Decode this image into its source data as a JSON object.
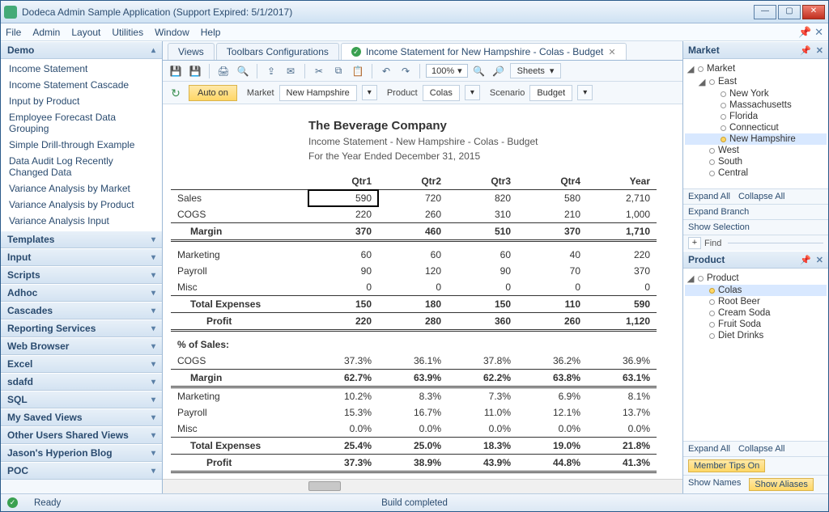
{
  "window": {
    "title": "Dodeca Admin Sample Application (Support Expired: 5/1/2017)"
  },
  "menu": [
    "File",
    "Admin",
    "Layout",
    "Utilities",
    "Window",
    "Help"
  ],
  "sidebar": {
    "groups": [
      {
        "label": "Demo",
        "open": true,
        "items": [
          "Income Statement",
          "Income Statement Cascade",
          "Input by Product",
          "Employee Forecast Data Grouping",
          "Simple Drill-through Example",
          "Data Audit Log Recently Changed Data",
          "Variance Analysis by Market",
          "Variance Analysis by Product",
          "Variance Analysis Input"
        ]
      },
      {
        "label": "Templates"
      },
      {
        "label": "Input"
      },
      {
        "label": "Scripts"
      },
      {
        "label": "Adhoc"
      },
      {
        "label": "Cascades"
      },
      {
        "label": "Reporting Services"
      },
      {
        "label": "Web Browser"
      },
      {
        "label": "Excel"
      },
      {
        "label": "sdafd"
      },
      {
        "label": "SQL"
      },
      {
        "label": "My Saved Views"
      },
      {
        "label": "Other Users Shared Views"
      },
      {
        "label": "Jason's Hyperion Blog"
      },
      {
        "label": "POC"
      }
    ]
  },
  "tabs": [
    {
      "label": "Views",
      "active": false
    },
    {
      "label": "Toolbars Configurations",
      "active": false
    },
    {
      "label": "Income Statement for New Hampshire - Colas - Budget",
      "active": true,
      "icon": "check",
      "closable": true
    }
  ],
  "toolbar": {
    "zoom": "100%",
    "sheets_btn": "Sheets"
  },
  "pov": {
    "auto_on": "Auto on",
    "dims": [
      {
        "label": "Market",
        "value": "New Hampshire"
      },
      {
        "label": "Product",
        "value": "Colas"
      },
      {
        "label": "Scenario",
        "value": "Budget"
      }
    ]
  },
  "report": {
    "title": "The Beverage Company",
    "subtitle1": "Income Statement - New Hampshire - Colas - Budget",
    "subtitle2": "For the Year Ended December 31, 2015",
    "columns": [
      "Qtr1",
      "Qtr2",
      "Qtr3",
      "Qtr4",
      "Year"
    ],
    "section_label": "% of Sales:",
    "rows": [
      {
        "label": "Sales",
        "v": [
          "590",
          "720",
          "820",
          "580",
          "2,710"
        ],
        "active_col": 0
      },
      {
        "label": "COGS",
        "v": [
          "220",
          "260",
          "310",
          "210",
          "1,000"
        ],
        "underline": true
      },
      {
        "label": "Margin",
        "v": [
          "370",
          "460",
          "510",
          "370",
          "1,710"
        ],
        "bold": true,
        "indent": 1,
        "double": true
      },
      {
        "spacer": true
      },
      {
        "label": "Marketing",
        "v": [
          "60",
          "60",
          "60",
          "40",
          "220"
        ]
      },
      {
        "label": "Payroll",
        "v": [
          "90",
          "120",
          "90",
          "70",
          "370"
        ]
      },
      {
        "label": "Misc",
        "v": [
          "0",
          "0",
          "0",
          "0",
          "0"
        ],
        "underline": true
      },
      {
        "label": "Total Expenses",
        "v": [
          "150",
          "180",
          "150",
          "110",
          "590"
        ],
        "bold": true,
        "indent": 1,
        "underline": true
      },
      {
        "label": "Profit",
        "v": [
          "220",
          "280",
          "360",
          "260",
          "1,120"
        ],
        "bold": true,
        "indent": 2,
        "double": true
      },
      {
        "spacer": true
      }
    ],
    "pct_rows": [
      {
        "label": "COGS",
        "v": [
          "37.3%",
          "36.1%",
          "37.8%",
          "36.2%",
          "36.9%"
        ],
        "underline": true
      },
      {
        "label": "Margin",
        "v": [
          "62.7%",
          "63.9%",
          "62.2%",
          "63.8%",
          "63.1%"
        ],
        "bold": true,
        "indent": 1,
        "double": true
      },
      {
        "label": "Marketing",
        "v": [
          "10.2%",
          "8.3%",
          "7.3%",
          "6.9%",
          "8.1%"
        ]
      },
      {
        "label": "Payroll",
        "v": [
          "15.3%",
          "16.7%",
          "11.0%",
          "12.1%",
          "13.7%"
        ]
      },
      {
        "label": "Misc",
        "v": [
          "0.0%",
          "0.0%",
          "0.0%",
          "0.0%",
          "0.0%"
        ],
        "underline": true
      },
      {
        "label": "Total Expenses",
        "v": [
          "25.4%",
          "25.0%",
          "18.3%",
          "19.0%",
          "21.8%"
        ],
        "bold": true,
        "indent": 1,
        "underline": true
      },
      {
        "label": "Profit",
        "v": [
          "37.3%",
          "38.9%",
          "43.9%",
          "44.8%",
          "41.3%"
        ],
        "bold": true,
        "indent": 2,
        "double": true
      }
    ]
  },
  "market_tree": {
    "title": "Market",
    "expand_all": "Expand All",
    "collapse_all": "Collapse All",
    "expand_branch": "Expand Branch",
    "show_selection": "Show Selection",
    "find": "Find",
    "root": {
      "label": "Market",
      "children": [
        {
          "label": "East",
          "open": true,
          "children": [
            {
              "label": "New York"
            },
            {
              "label": "Massachusetts"
            },
            {
              "label": "Florida"
            },
            {
              "label": "Connecticut"
            },
            {
              "label": "New Hampshire",
              "selected": true
            }
          ]
        },
        {
          "label": "West"
        },
        {
          "label": "South"
        },
        {
          "label": "Central"
        }
      ]
    }
  },
  "product_tree": {
    "title": "Product",
    "expand_all": "Expand All",
    "collapse_all": "Collapse All",
    "member_tips": "Member Tips On",
    "show_names": "Show Names",
    "show_aliases": "Show Aliases",
    "root": {
      "label": "Product",
      "children": [
        {
          "label": "Colas",
          "selected": true
        },
        {
          "label": "Root Beer"
        },
        {
          "label": "Cream Soda"
        },
        {
          "label": "Fruit Soda"
        },
        {
          "label": "Diet Drinks"
        }
      ]
    }
  },
  "status": {
    "ready": "Ready",
    "build": "Build completed"
  }
}
